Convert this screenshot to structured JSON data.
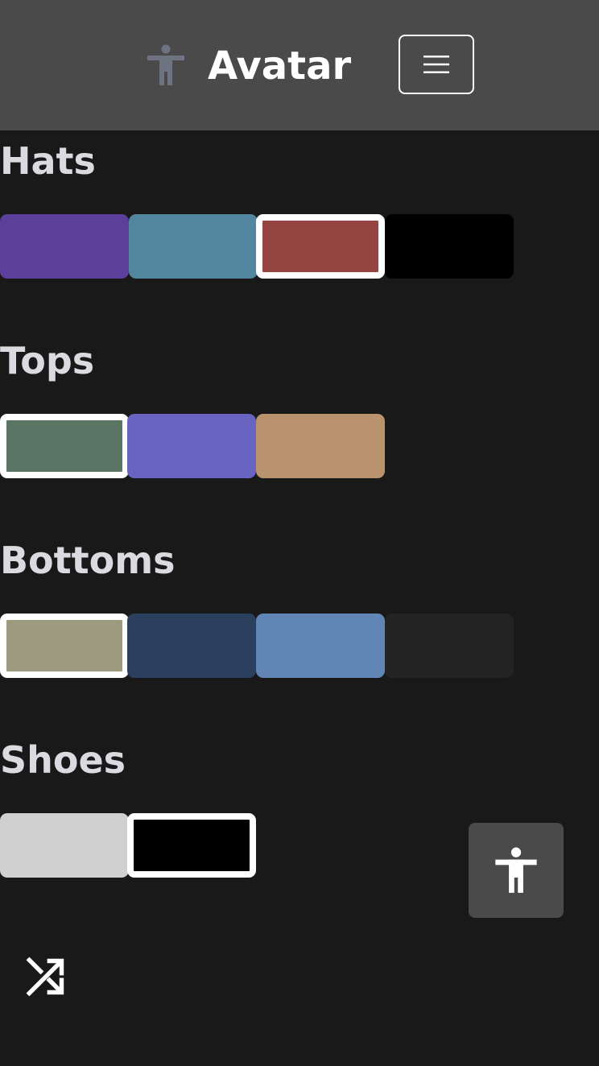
{
  "header": {
    "title": "Avatar",
    "logo_icon": "accessibility-person-icon",
    "menu_icon": "hamburger-menu-icon",
    "background": "#4a4a4a"
  },
  "sections": [
    {
      "title": "Hats",
      "swatches": [
        {
          "color": "#5b3f9a",
          "selected": false
        },
        {
          "color": "#52869f",
          "selected": false
        },
        {
          "color": "#974542",
          "selected": true
        },
        {
          "color": "#000000",
          "selected": false
        }
      ]
    },
    {
      "title": "Tops",
      "swatches": [
        {
          "color": "#5a7564",
          "selected": true
        },
        {
          "color": "#6964c2",
          "selected": false
        },
        {
          "color": "#b8936d",
          "selected": false
        }
      ]
    },
    {
      "title": "Bottoms",
      "swatches": [
        {
          "color": "#9c9b80",
          "selected": true
        },
        {
          "color": "#2b405e",
          "selected": false
        },
        {
          "color": "#6186b6",
          "selected": false
        },
        {
          "color": "#232323",
          "selected": false
        }
      ]
    },
    {
      "title": "Shoes",
      "swatches": [
        {
          "color": "#d0d0d0",
          "selected": false
        },
        {
          "color": "#000000",
          "selected": true
        }
      ]
    }
  ],
  "floating_buttons": {
    "accessibility_icon": "accessibility-person-icon",
    "shuffle_icon": "shuffle-icon"
  },
  "colors": {
    "page_background": "#191919",
    "section_title": "#dadbe0",
    "selected_border": "#ffffff"
  }
}
